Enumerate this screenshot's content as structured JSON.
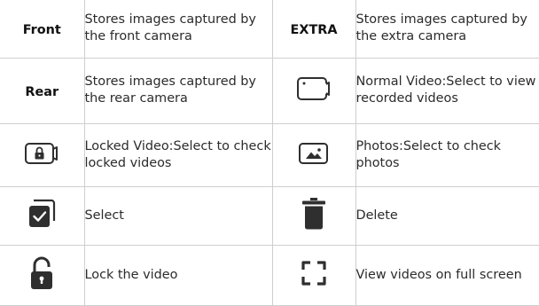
{
  "rows": [
    {
      "left": {
        "icon_label": "Front",
        "desc": "Stores images captured by the front camera"
      },
      "right": {
        "icon_label": "EXTRA",
        "desc": "Stores images captured by the extra camera"
      }
    },
    {
      "left": {
        "icon_label": "Rear",
        "desc": "Stores images captured by the rear camera"
      },
      "right": {
        "icon": "normal-video-icon",
        "desc": "Normal Video:Select to view recorded videos"
      }
    },
    {
      "left": {
        "icon": "locked-video-icon",
        "desc": "Locked Video:Select to check locked videos"
      },
      "right": {
        "icon": "photos-icon",
        "desc": "Photos:Select to check photos"
      }
    },
    {
      "left": {
        "icon": "select-checkbox-icon",
        "desc": "Select"
      },
      "right": {
        "icon": "trash-icon",
        "desc": "Delete"
      }
    },
    {
      "left": {
        "icon": "unlock-icon",
        "desc": "Lock the video"
      },
      "right": {
        "icon": "fullscreen-icon",
        "desc": "View videos on full screen"
      }
    }
  ],
  "colors": {
    "icon_dark": "#2f2f2f",
    "border": "#cfcfcf",
    "text": "#2b2b2b"
  }
}
